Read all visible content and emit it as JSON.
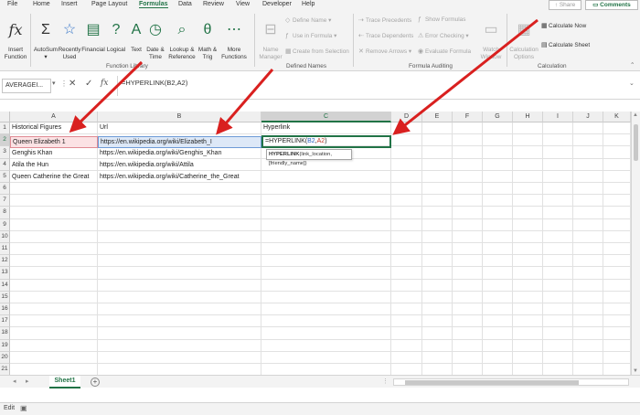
{
  "tabs": [
    {
      "label": "File"
    },
    {
      "label": "Home"
    },
    {
      "label": "Insert"
    },
    {
      "label": "Page Layout"
    },
    {
      "label": "Formulas"
    },
    {
      "label": "Data"
    },
    {
      "label": "Review"
    },
    {
      "label": "View"
    },
    {
      "label": "Developer"
    },
    {
      "label": "Help"
    }
  ],
  "share_label": "Share",
  "comments_label": "Comments",
  "ribbon": {
    "insert_function": "Insert\nFunction",
    "autosum": "AutoSum",
    "recently_used": "Recently\nUsed",
    "financial": "Financial",
    "logical": "Logical",
    "text": "Text",
    "date_time": "Date &\nTime",
    "lookup_reference": "Lookup &\nReference",
    "math_trig": "Math &\nTrig",
    "more_functions": "More\nFunctions",
    "function_library_label": "Function Library",
    "name_manager": "Name\nManager",
    "define_name": "Define Name",
    "use_in_formula": "Use in Formula",
    "create_from_selection": "Create from Selection",
    "defined_names_label": "Defined Names",
    "trace_precedents": "Trace Precedents",
    "trace_dependents": "Trace Dependents",
    "remove_arrows": "Remove Arrows",
    "show_formulas": "Show Formulas",
    "error_checking": "Error Checking",
    "evaluate_formula": "Evaluate Formula",
    "watch_window": "Watch\nWindow",
    "formula_auditing_label": "Formula Auditing",
    "calculation_options": "Calculation\nOptions",
    "calculate_now": "Calculate Now",
    "calculate_sheet": "Calculate Sheet",
    "calculation_label": "Calculation"
  },
  "formula_bar": {
    "name_box": "AVERAGEI...",
    "formula": "=HYPERLINK(B2,A2)",
    "fx": "fx"
  },
  "columns": [
    "A",
    "B",
    "C",
    "D",
    "E",
    "F",
    "G",
    "H",
    "I",
    "J",
    "K"
  ],
  "rows": [
    "1",
    "2",
    "3",
    "4",
    "5",
    "6",
    "7",
    "8",
    "9",
    "10",
    "11",
    "12",
    "13",
    "14",
    "15",
    "16",
    "17",
    "18",
    "19",
    "20",
    "21"
  ],
  "cells": {
    "A1": "Historical Figures",
    "B1": "Url",
    "C1": "Hyperlink",
    "A2": "Queen Elizabeth 1",
    "B2": "https://en.wikipedia.org/wiki/Elizabeth_I",
    "C2_parts": [
      "=HYPERLINK(",
      "B2",
      ",",
      "A2",
      ")"
    ],
    "A3": "Genghis Khan",
    "B3": "https://en.wikipedia.org/wiki/Genghis_Khan",
    "A4": "Atila the Hun",
    "B4": "https://en.wikipedia.org/wiki/Attila",
    "A5": "Queen Catherine the Great",
    "B5": "https://en.wikipedia.org/wiki/Catherine_the_Great"
  },
  "tooltip": {
    "func": "HYPERLINK",
    "args": "(link_location, [friendly_name])"
  },
  "sheet_tab": "Sheet1",
  "status": "Edit",
  "colors": {
    "accent": "#217346",
    "arrow": "#d9201f",
    "ref_blue": "#2b62c0",
    "ref_red": "#c0392b"
  }
}
